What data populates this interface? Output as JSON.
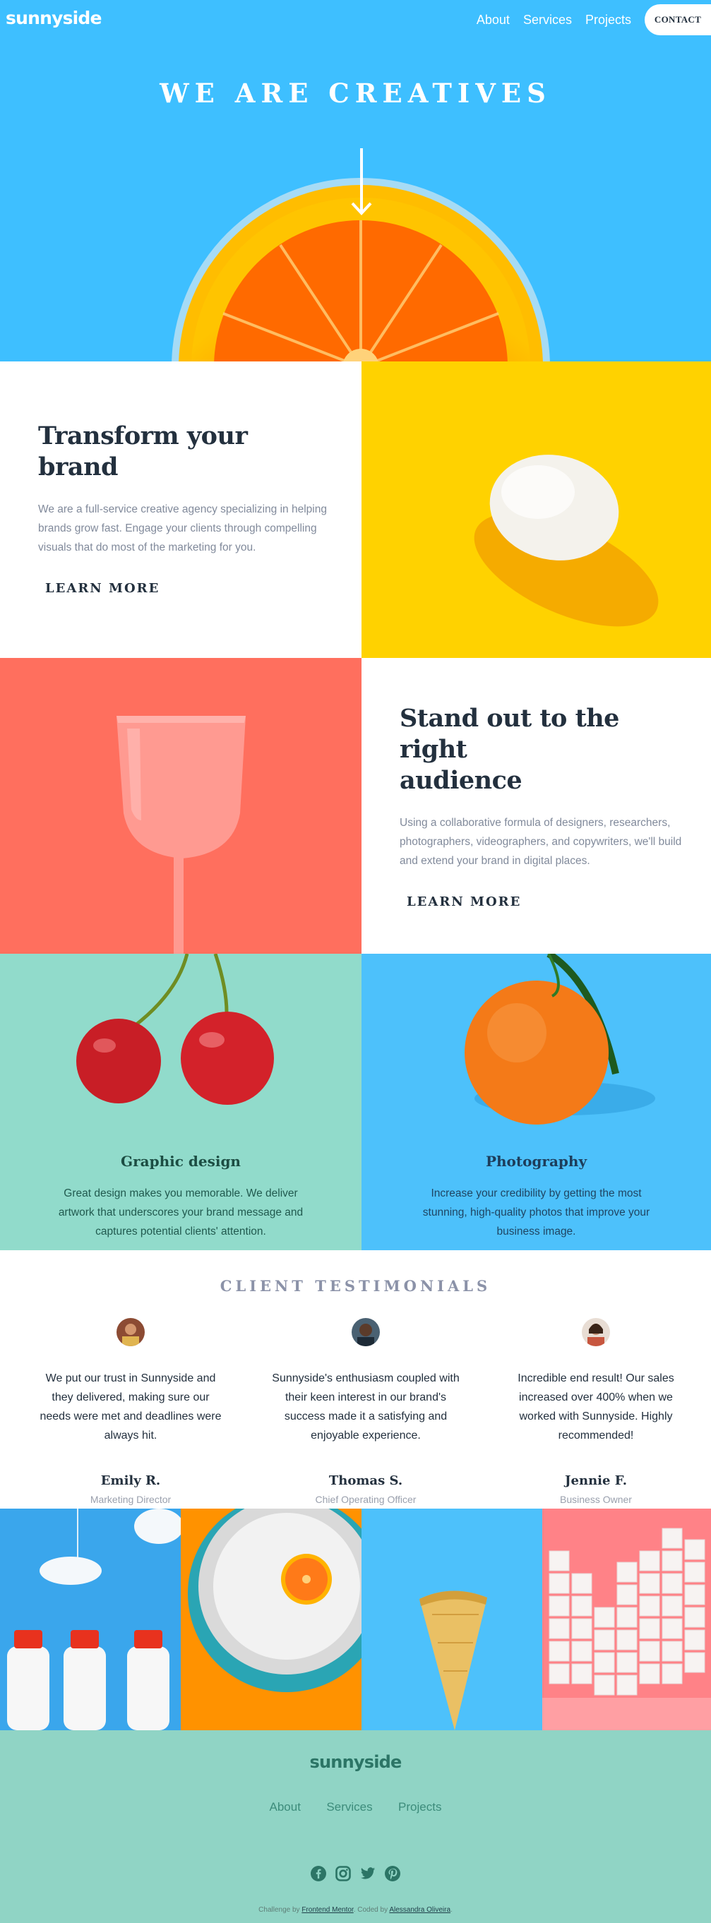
{
  "header": {
    "logo": "sunnyside",
    "nav": [
      "About",
      "Services",
      "Projects"
    ],
    "contact_label": "CONTACT"
  },
  "hero": {
    "title": "WE ARE CREATIVES"
  },
  "transform": {
    "title": "Transform your brand",
    "body": "We are a full-service creative agency specializing in helping brands grow fast. Engage your clients through compelling visuals that do most of the marketing for you.",
    "cta": "LEARN MORE",
    "highlight_color": "#fad400"
  },
  "standout": {
    "title_line1": "Stand out to the right",
    "title_line2": "audience",
    "body": "Using a collaborative formula of designers, researchers, photographers, videographers, and copywriters, we'll build and extend your brand in digital places.",
    "cta": "LEARN MORE",
    "highlight_color": "#fe7865"
  },
  "services": [
    {
      "title": "Graphic design",
      "body": "Great design makes you memorable. We deliver artwork that underscores your brand message and captures potential clients' attention."
    },
    {
      "title": "Photography",
      "body": "Increase your credibility by getting the most stunning, high-quality photos that improve your business image."
    }
  ],
  "testimonials": {
    "heading": "CLIENT TESTIMONIALS",
    "items": [
      {
        "quote": "We put our trust in Sunnyside and they delivered, making sure our needs were met and deadlines were always hit.",
        "name": "Emily R.",
        "role": "Marketing Director"
      },
      {
        "quote": "Sunnyside's enthusiasm coupled with their keen interest in our brand's success made it a satisfying and enjoyable experience.",
        "name": "Thomas S.",
        "role": "Chief Operating Officer"
      },
      {
        "quote": "Incredible end result! Our sales increased over 400% when we worked with Sunnyside. Highly recommended!",
        "name": "Jennie F.",
        "role": "Business Owner"
      }
    ]
  },
  "footer": {
    "logo": "sunnyside",
    "nav": [
      "About",
      "Services",
      "Projects"
    ],
    "social_icons": [
      "facebook-icon",
      "instagram-icon",
      "twitter-icon",
      "pinterest-icon"
    ],
    "credit_prefix": "Challenge by",
    "credit_link1": "Frontend Mentor",
    "credit_mid": ". Coded by",
    "credit_link2": "Alessandra Oliveira",
    "credit_suffix": "."
  },
  "colors": {
    "hero_bg": "#3ebfff",
    "yellow": "#ffd200",
    "coral": "#ff6b5a",
    "mint": "#90d4c5",
    "dark": "#23303e",
    "graphic_text": "#1f5c50",
    "photo_text": "#22405e"
  }
}
